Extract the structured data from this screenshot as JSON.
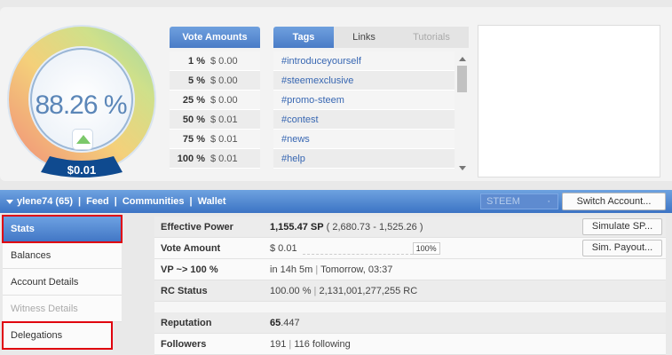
{
  "gauge": {
    "percent_label": "88.26 %",
    "amount_label": "$0.01",
    "level": 0.8826
  },
  "vote_amounts": {
    "header": "Vote Amounts",
    "rows": [
      {
        "pct": "1 %",
        "amount": "$ 0.00"
      },
      {
        "pct": "5 %",
        "amount": "$ 0.00"
      },
      {
        "pct": "25 %",
        "amount": "$ 0.00"
      },
      {
        "pct": "50 %",
        "amount": "$ 0.01"
      },
      {
        "pct": "75 %",
        "amount": "$ 0.01"
      },
      {
        "pct": "100 %",
        "amount": "$ 0.01"
      }
    ]
  },
  "tags_panel": {
    "tabs": [
      "Tags",
      "Links",
      "Tutorials"
    ],
    "tags": [
      "#introduceyourself",
      "#steemexclusive",
      "#promo-steem",
      "#contest",
      "#news",
      "#help"
    ]
  },
  "navbar": {
    "account": "ylene74 (65)",
    "feed": "Feed",
    "communities": "Communities",
    "wallet": "Wallet",
    "sep": "|",
    "currency": "STEEM",
    "currency_dot": "·",
    "switch_account": "Switch Account..."
  },
  "menu": {
    "stats": "Stats",
    "balances": "Balances",
    "account_details": "Account Details",
    "witness_details": "Witness Details",
    "delegations": "Delegations"
  },
  "stats": {
    "effective_power_label": "Effective Power",
    "effective_power_value": "1,155.47 SP",
    "effective_power_detail": "( 2,680.73 - 1,525.26 )",
    "simulate_sp": "Simulate SP...",
    "vote_amount_label": "Vote Amount",
    "vote_amount_value": "$ 0.01",
    "vote_amount_pct": "100%",
    "sim_payout": "Sim. Payout...",
    "vp_label": "VP ~> 100 %",
    "vp_value": "in 14h 5m",
    "vp_sep": "|",
    "vp_tomorrow": "Tomorrow, 03:37",
    "rc_label": "RC Status",
    "rc_pct": "100.00 %",
    "rc_sep": "|",
    "rc_value": "2,131,001,277,255 RC",
    "reputation_label": "Reputation",
    "reputation_int": "65",
    "reputation_dec": ".447",
    "followers_label": "Followers",
    "followers_value": "191",
    "followers_sep": "|",
    "following_value": "116 following"
  },
  "colors": {
    "accent_blue": "#4a7cc7",
    "highlight_red": "#e0000e",
    "gauge_text": "#5b86b8"
  }
}
